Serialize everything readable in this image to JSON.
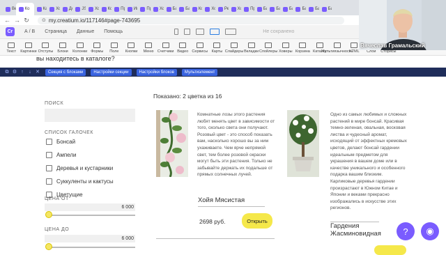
{
  "browser": {
    "tabs": [
      {
        "label": "Ве"
      },
      {
        "label": "Ко"
      },
      {
        "label": "Ка"
      },
      {
        "label": "Хо"
      },
      {
        "label": "До"
      },
      {
        "label": "JS"
      },
      {
        "label": "Хо"
      },
      {
        "label": "Ко"
      },
      {
        "label": "Пр"
      },
      {
        "label": "Ин"
      },
      {
        "label": "Пр"
      },
      {
        "label": "Хо"
      },
      {
        "label": "Ба"
      },
      {
        "label": "Ба"
      },
      {
        "label": "Ко"
      },
      {
        "label": "Хо"
      },
      {
        "label": "Ре"
      },
      {
        "label": "Хо"
      },
      {
        "label": "Пр"
      },
      {
        "label": "Ба"
      },
      {
        "label": "Ба"
      },
      {
        "label": "Ба"
      },
      {
        "label": "Ба"
      },
      {
        "label": "Ба"
      },
      {
        "label": "Ба"
      }
    ],
    "url": "my.creatium.io/117146#page-743695"
  },
  "editor": {
    "logo": "Cr",
    "ab": "А / В",
    "menu_page": "Страница",
    "menu_data": "Данные",
    "menu_help": "Помощь",
    "saved": "Не сохранено"
  },
  "widgets": [
    {
      "label": "Текст"
    },
    {
      "label": "Картинки"
    },
    {
      "label": "Отступы"
    },
    {
      "label": "Блоки"
    },
    {
      "label": "Колонки"
    },
    {
      "label": "Формы"
    },
    {
      "label": "Поле"
    },
    {
      "label": "Кнопки"
    },
    {
      "label": "Меню"
    },
    {
      "label": "Счетчики"
    },
    {
      "label": "Видео"
    },
    {
      "label": "Сервисы"
    },
    {
      "label": "Карты"
    },
    {
      "label": "Слайдеры"
    },
    {
      "label": "Вкладки"
    },
    {
      "label": "Спойлеры"
    },
    {
      "label": "Ховеры"
    },
    {
      "label": "Корзина"
    },
    {
      "label": "Каталог"
    },
    {
      "label": "Мультиязычность"
    },
    {
      "label": "HTML"
    },
    {
      "label": "Слои"
    },
    {
      "label": "Сторисы"
    }
  ],
  "partial_heading": "вы находитесь в каталоге?",
  "editbar": {
    "section_label": "Секция с блоками",
    "section_settings": "Настройки секции",
    "block_settings": "Настройки блоков",
    "multielement": "Мультиэлемент"
  },
  "sidebar": {
    "search_title": "ПОИСК",
    "categories_title": "СПИСОК ГАЛОЧЕК",
    "categories": [
      {
        "label": "Бонсай"
      },
      {
        "label": "Ампели"
      },
      {
        "label": "Деревья и кустарники"
      },
      {
        "label": "Суккуленты и кактусы"
      },
      {
        "label": "Цветущие"
      }
    ],
    "price_from_title": "ЦЕНА ОТ",
    "price_from_value": "6 000",
    "price_to_title": "ЦЕНА ДО",
    "price_to_value": "6 000"
  },
  "catalog": {
    "shown": "Показано: 2 цветка из 16",
    "products": [
      {
        "description": "Комнатные лозы этого растения любят менять цвет в зависимости от того, сколько света они получают. Розовый цвет - это способ показать вам, насколько хорошо вы за ним ухаживаете. Чем ярче непрямой свет, тем более розовой окраски могут быть эти растения. Только не забывайте держать их подальше от прямых солнечных лучей.",
        "name": "Хойя Мясистая",
        "price": "2698 руб.",
        "buy_label": "Открыть"
      },
      {
        "description": "Одно из самых любимых и сложных растений в мире бонсай. Красивая темно-зеленая, овальная, восковая листва и чудесный аромат, исходящий от эффектных кремовых цветов, делают бонсай гардении идеальным предметом для украшения в вашем доме или в качестве уникального и особенного подарка вашим близким. Карликовые деревья гардении произрастают в Южном Китае и Японии и веками прекрасно изображались в искусстве этих регионов.",
        "name": "Гардения Жасминовидная"
      }
    ]
  },
  "webcam": {
    "name": "Вячеслав Грамальский"
  },
  "colors": {
    "accent": "#7a5cff",
    "button_yellow": "#f5e84a",
    "editbar_blue": "#1f2d5a"
  }
}
